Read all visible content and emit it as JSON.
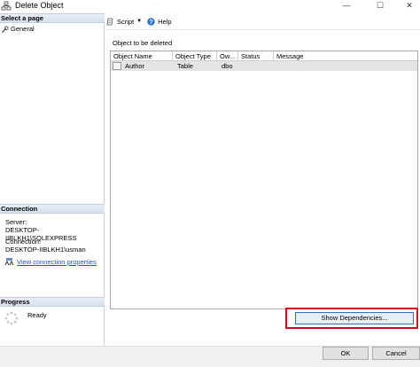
{
  "window": {
    "title": "Delete Object",
    "minimize_glyph": "—",
    "maximize_glyph": "☐",
    "close_glyph": "✕"
  },
  "left_pane": {
    "select_page_header": "Select a page",
    "pages": [
      {
        "label": "General",
        "icon": "wrench-icon"
      }
    ],
    "connection_header": "Connection",
    "server_label": "Server:",
    "server_value": "DESKTOP-IIBLKH1\\SQLEXPRESS",
    "connection_label": "Connection:",
    "connection_value": "DESKTOP-IIBLKH1\\usman",
    "view_connection_link": "View connection properties",
    "progress_header": "Progress",
    "progress_status": "Ready"
  },
  "toolbar": {
    "script_label": "Script",
    "help_label": "Help"
  },
  "main": {
    "objects_label": "Object to be deleted",
    "columns": [
      "Object Name",
      "Object Type",
      "Ow...",
      "Status",
      "Message"
    ],
    "rows": [
      {
        "name": "Author",
        "type": "Table",
        "owner": "dbo",
        "status": "",
        "message": ""
      }
    ],
    "show_dependencies_label": "Show Dependencies..."
  },
  "footer": {
    "ok_label": "OK",
    "cancel_label": "Cancel"
  },
  "colors": {
    "highlight_border": "#d0021b",
    "link": "#1a55c7",
    "section_header": "#d6dfee"
  }
}
